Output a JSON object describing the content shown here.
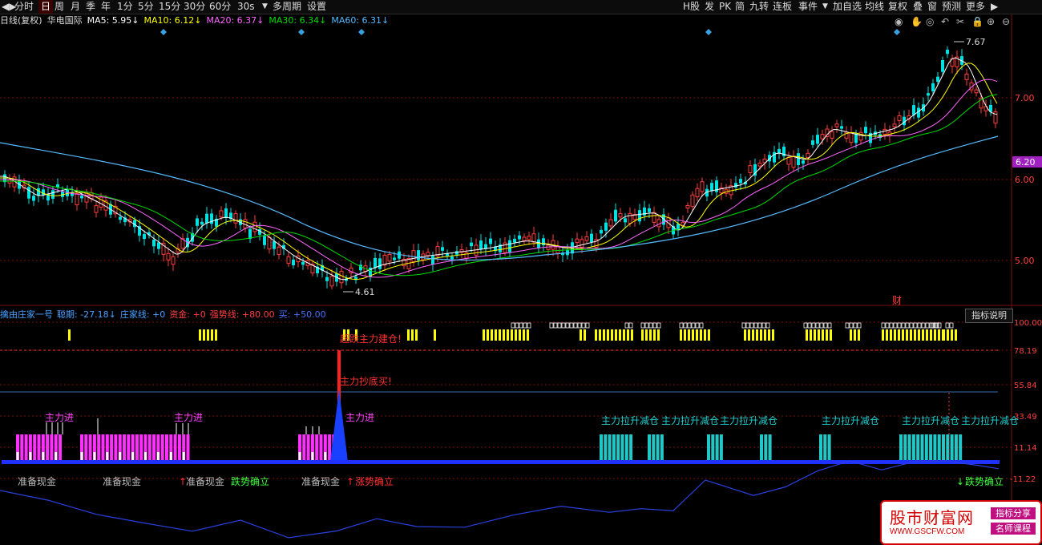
{
  "toolbar": {
    "left": [
      "◀▶",
      "分时",
      "日",
      "周",
      "月",
      "季",
      "年",
      "1分",
      "5分",
      "15分",
      "30分",
      "60分",
      "30s",
      "▼",
      "多周期",
      "设置"
    ],
    "right": [
      "H股",
      "发",
      "PK",
      "简",
      "九转",
      "连板",
      "事件",
      "▼",
      "加自选",
      "均线",
      "复权",
      "叠",
      "窗",
      "预测",
      "更多",
      "▶"
    ],
    "selected": "日"
  },
  "ma_header": {
    "title": "日线(复权)",
    "stock": "华电国际",
    "ma5": "MA5: 5.95↓",
    "ma10": "MA10: 6.12↓",
    "ma20": "MA20: 6.37↓",
    "ma30": "MA30: 6.34↓",
    "ma60": "MA60: 6.31↓"
  },
  "price_axis": [
    "7.00",
    "6.00",
    "5.00"
  ],
  "current_price": "6.20",
  "high_label": "7.67",
  "low_label": "4.61",
  "cai_label": "财",
  "indicator_header": {
    "name": "擒由庄家一号",
    "zhaoji": "聪期: -27.18↓",
    "zhuangjia": "庄家线: +0",
    "zijin": "资金: +0",
    "qiangshi": "强势线: +80.00",
    "mai": "买: +50.00"
  },
  "indicator_button": "指标说明",
  "ind_axis": [
    "100.00",
    "78.19",
    "55.84",
    "33.49",
    "11.14",
    "-11.22"
  ],
  "annotations": {
    "chaodi_jiancang": "超跌主力建仓!",
    "chaodi_mai": "主力抄底买!",
    "zhuli_jin": "主力进",
    "lasheng": "主力拉升减仓",
    "zhunbei": "准备现金",
    "diedie": "跌势确立",
    "zhangshi": "涨势确立"
  },
  "logo": {
    "title": "股市财富网",
    "url": "WWW.GSCFW.COM",
    "btn1": "指标分享",
    "btn2": "名师课程"
  },
  "colors": {
    "up": "#ff3b3b",
    "down": "#00e0e0",
    "ma5": "#ffffff",
    "ma10": "#ffff00",
    "ma20": "#ff66ff",
    "ma30": "#00dd00",
    "ma60": "#55bbff"
  }
}
